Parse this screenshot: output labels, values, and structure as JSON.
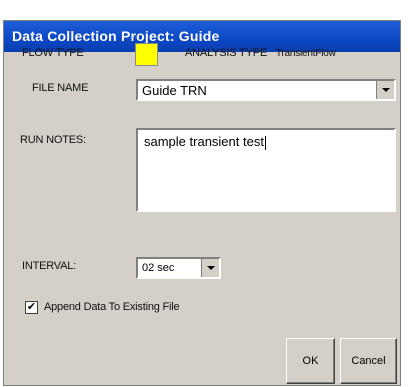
{
  "window": {
    "title": "Data Collection Project: Guide"
  },
  "flow_type": {
    "label": "FLOW TYPE",
    "color": "#ffff00"
  },
  "analysis_type": {
    "label": "ANALYSIS TYPE",
    "value": "TransientFlow"
  },
  "file_name": {
    "label": "FILE NAME",
    "value": "Guide TRN"
  },
  "run_notes": {
    "label": "RUN NOTES:",
    "value": "sample transient test"
  },
  "interval": {
    "label": "INTERVAL:",
    "value": "02 sec"
  },
  "append": {
    "label": "Append Data To Existing File",
    "checked": true,
    "check_glyph": "✔"
  },
  "buttons": {
    "ok": "OK",
    "cancel": "Cancel"
  }
}
